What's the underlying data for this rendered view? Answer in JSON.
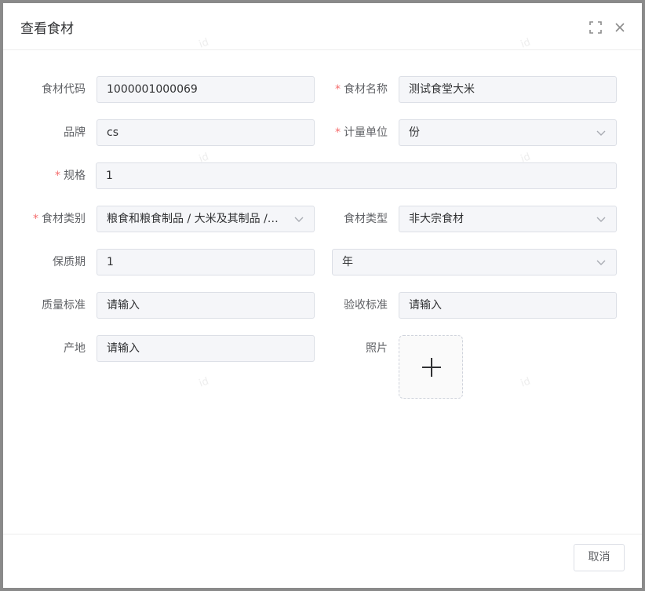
{
  "dialog": {
    "title": "查看食材"
  },
  "form": {
    "code": {
      "label": "食材代码",
      "value": "1000001000069"
    },
    "name": {
      "label": "食材名称",
      "value": "测试食堂大米",
      "required": true
    },
    "brand": {
      "label": "品牌",
      "value": "cs"
    },
    "unit": {
      "label": "计量单位",
      "value": "份",
      "required": true
    },
    "spec": {
      "label": "规格",
      "value": "1",
      "required": true
    },
    "category": {
      "label": "食材类别",
      "value": "粮食和粮食制品 / 大米及其制品 / 大米",
      "required": true
    },
    "material_type": {
      "label": "食材类型",
      "value": "非大宗食材"
    },
    "shelf_life": {
      "label": "保质期",
      "value": "1",
      "unit": "年"
    },
    "quality_standard": {
      "label": "质量标准",
      "placeholder": "请输入"
    },
    "acceptance_standard": {
      "label": "验收标准",
      "placeholder": "请输入"
    },
    "origin": {
      "label": "产地",
      "placeholder": "请输入"
    },
    "photo": {
      "label": "照片"
    }
  },
  "footer": {
    "cancel_label": "取消"
  },
  "required_mark": "*",
  "watermark_text": "id",
  "colors": {
    "required": "#f56c6c",
    "field_bg": "#f5f6f9",
    "border": "#dcdfe6",
    "overlay": "#8a8a8a"
  }
}
